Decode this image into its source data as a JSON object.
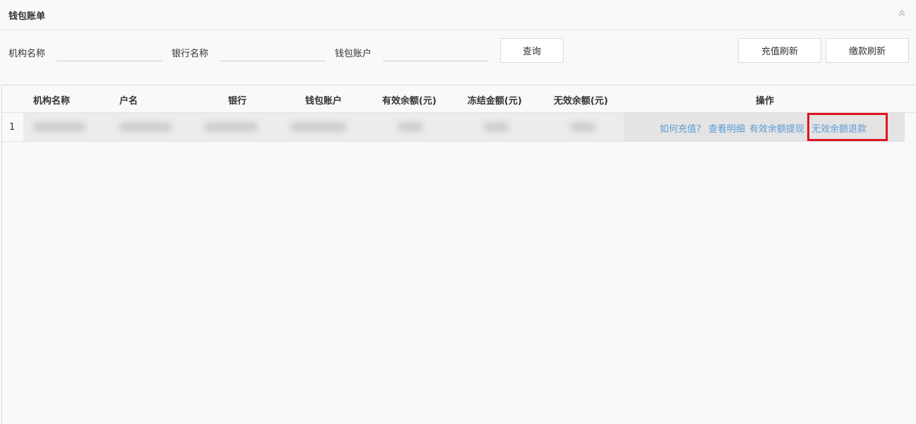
{
  "panel": {
    "title": "钱包账单"
  },
  "filters": {
    "org_label": "机构名称",
    "org_value": "",
    "bank_label": "银行名称",
    "bank_value": "",
    "wallet_label": "钱包账户",
    "wallet_value": "",
    "query_label": "查询"
  },
  "actions": {
    "recharge_refresh": "充值刷新",
    "payment_refresh": "缴款刷新"
  },
  "table": {
    "columns": [
      "机构名称",
      "户名",
      "银行",
      "钱包账户",
      "有效余额(元)",
      "冻结金额(元)",
      "无效余额(元)",
      "操作"
    ],
    "rows": [
      {
        "index": "1",
        "operations": [
          "如何充值?",
          "查看明细",
          "有效余额提现",
          "无效余额退款"
        ]
      }
    ]
  },
  "colors": {
    "link": "#5b9bd5",
    "highlight": "#e0141e"
  },
  "icons": {
    "collapse": "double-chevron-up-icon"
  }
}
